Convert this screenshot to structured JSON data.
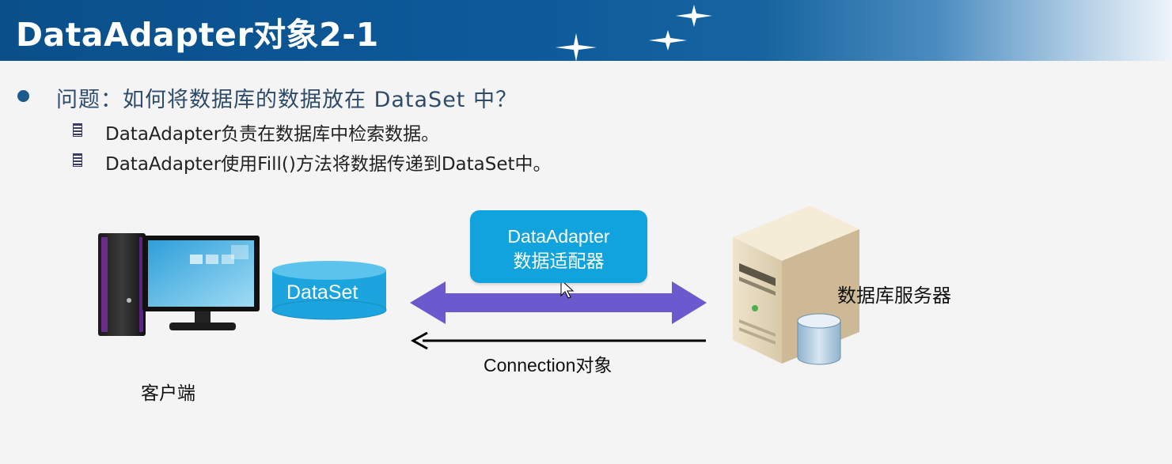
{
  "header": {
    "title": "DataAdapter对象2-1"
  },
  "question": "问题：如何将数据库的数据放在 DataSet 中？",
  "sub_points": [
    "DataAdapter负责在数据库中检索数据。",
    "DataAdapter使用Fill()方法将数据传递到DataSet中。"
  ],
  "diagram": {
    "dataset_label": "DataSet",
    "adapter_line1": "DataAdapter",
    "adapter_line2": "数据适配器",
    "connection_label": "Connection对象",
    "client_label": "客户端",
    "server_label": "数据库服务器"
  },
  "colors": {
    "header_blue": "#0d5a9b",
    "adapter_blue": "#11a3dd",
    "arrow_purple": "#6a5acd",
    "dataset_blue": "#1ba4de"
  }
}
